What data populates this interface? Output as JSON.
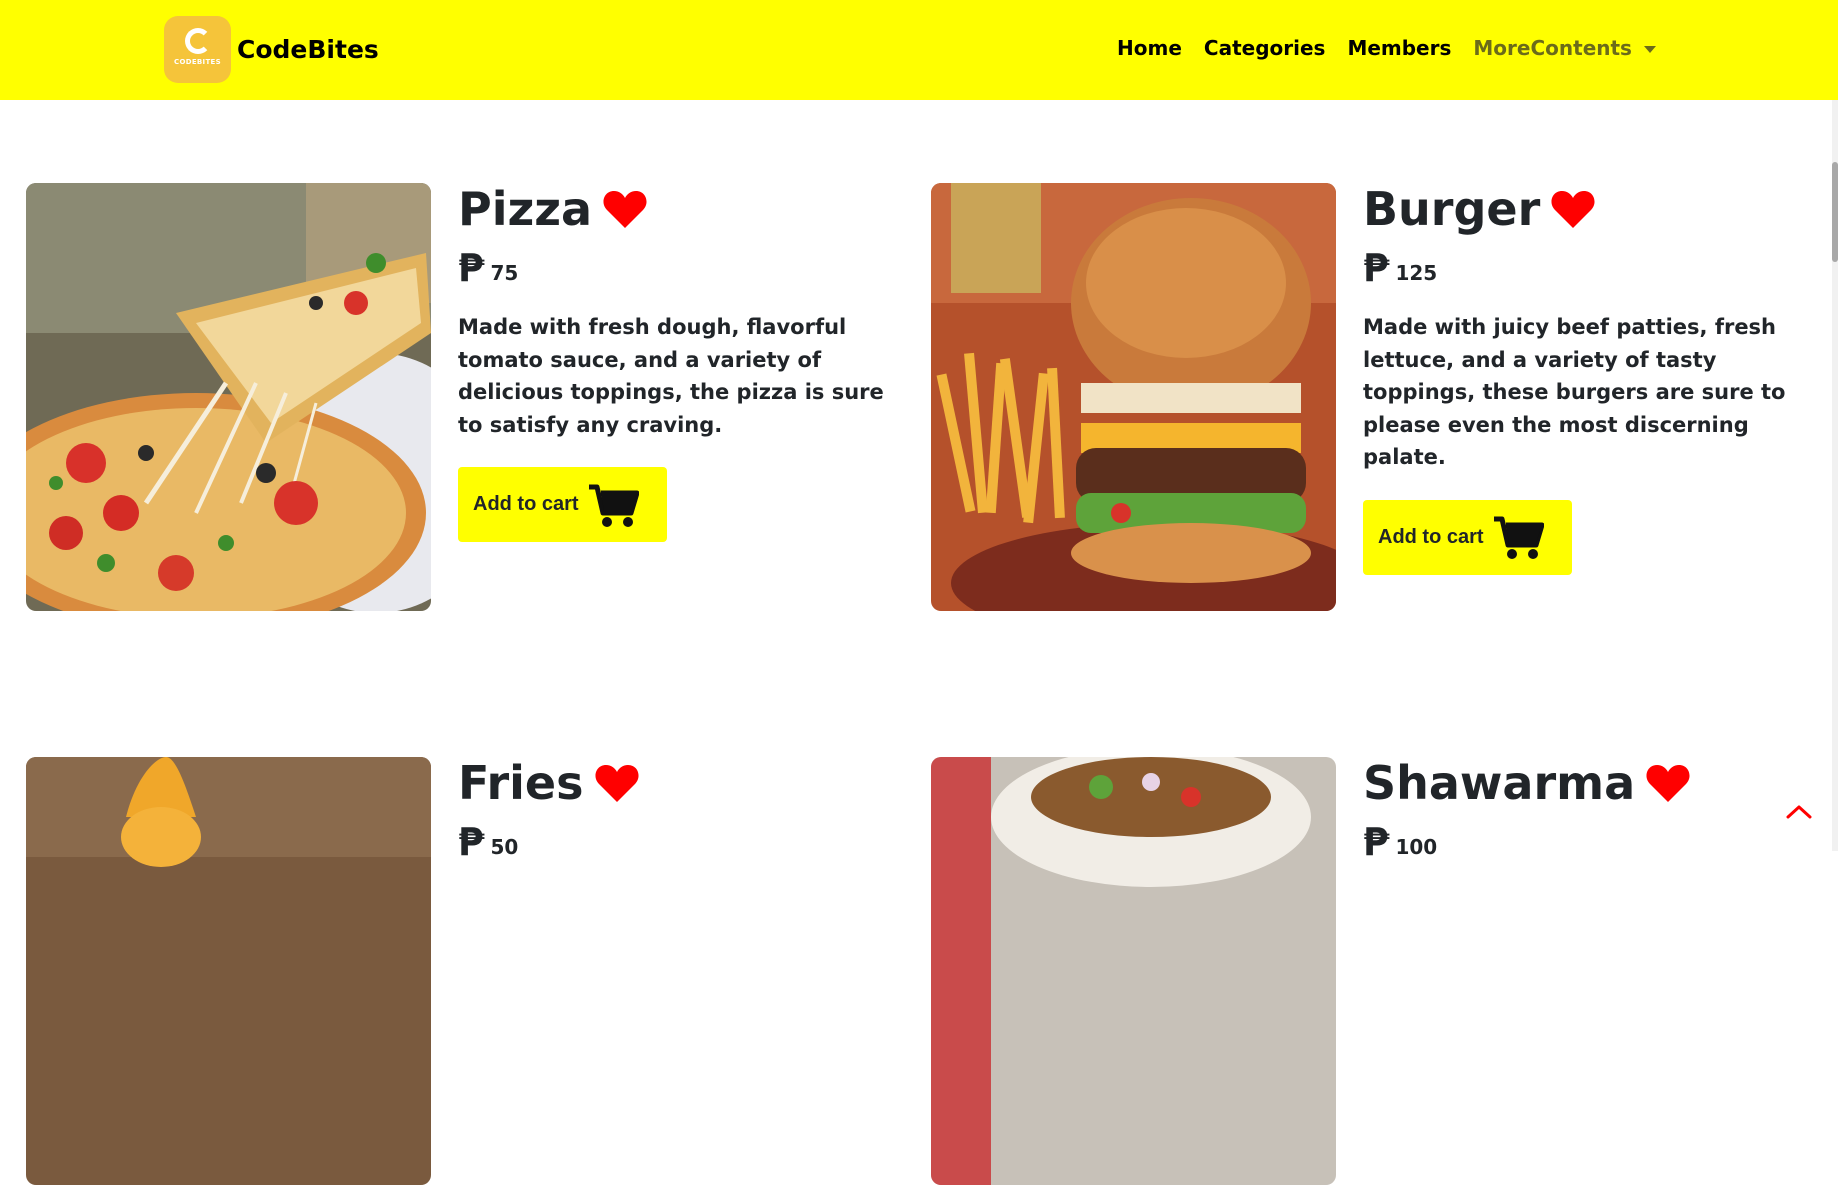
{
  "brand": {
    "name": "CodeBites",
    "logo_text": "CODEBITES"
  },
  "nav": {
    "home": "Home",
    "categories": "Categories",
    "members": "Members",
    "more": "MoreContents"
  },
  "colors": {
    "accent": "#ffff00",
    "heart": "#ff0000",
    "text": "#212529"
  },
  "currency_symbol": "₱",
  "items": [
    {
      "name": "Pizza",
      "price": "75",
      "description": "Made with fresh dough, flavorful tomato sauce, and a variety of delicious toppings, the pizza is sure to satisfy any craving.",
      "button": "Add to cart"
    },
    {
      "name": "Burger",
      "price": "125",
      "description": "Made with juicy beef patties, fresh lettuce, and a variety of tasty toppings, these burgers are sure to please even the most discerning palate.",
      "button": "Add to cart"
    },
    {
      "name": "Fries",
      "price": "50"
    },
    {
      "name": "Shawarma",
      "price": "100"
    }
  ],
  "icons": {
    "favorite": "heart-icon",
    "cart": "cart-icon",
    "back_to_top": "chevron-up-icon"
  }
}
